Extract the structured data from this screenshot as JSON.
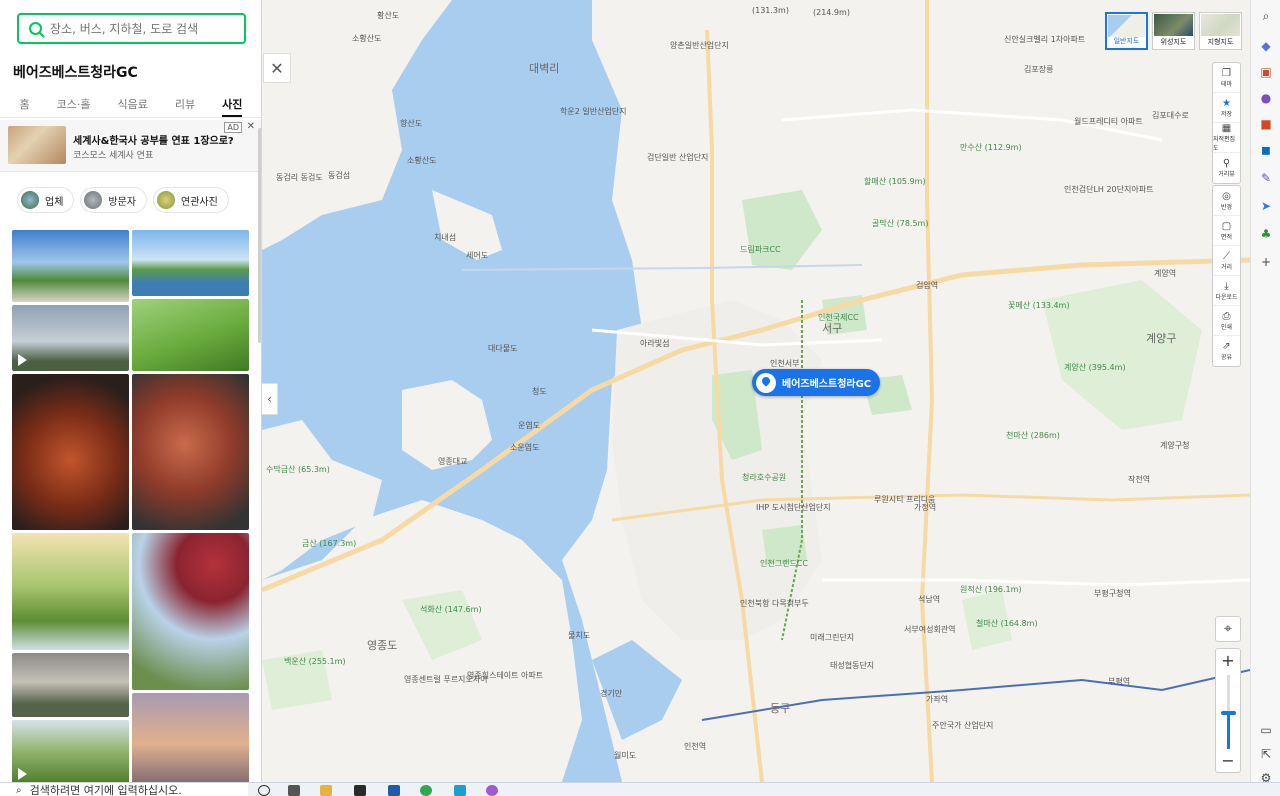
{
  "search": {
    "placeholder": "장소, 버스, 지하철, 도로 검색"
  },
  "place": {
    "title": "베어즈베스트청라GC"
  },
  "tabs": [
    {
      "label": "홈"
    },
    {
      "label": "코스·홀"
    },
    {
      "label": "식음료"
    },
    {
      "label": "리뷰"
    },
    {
      "label": "사진"
    }
  ],
  "ad": {
    "title": "세계사&한국사 공부를 연표 1장으로?",
    "subtitle": "코스모스 세계사 연표",
    "badge": "AD",
    "close": "✕"
  },
  "filters": [
    {
      "label": "업체"
    },
    {
      "label": "방문자"
    },
    {
      "label": "연관사진"
    }
  ],
  "map": {
    "marker_label": "베어즈베스트청라GC",
    "map_types": [
      {
        "label": "일반지도"
      },
      {
        "label": "위성지도"
      },
      {
        "label": "지형지도"
      }
    ],
    "toolbar": [
      {
        "label": "테마",
        "icon": "layers-icon"
      },
      {
        "label": "저장",
        "icon": "star-icon"
      },
      {
        "label": "지적편집도",
        "icon": "grid-icon"
      },
      {
        "label": "거리뷰",
        "icon": "pin-icon"
      }
    ],
    "toolbar2": [
      {
        "label": "반경",
        "icon": "radius-icon"
      },
      {
        "label": "면적",
        "icon": "area-icon"
      },
      {
        "label": "거리",
        "icon": "ruler-icon"
      },
      {
        "label": "다운로드",
        "icon": "download-icon"
      },
      {
        "label": "인쇄",
        "icon": "print-icon"
      },
      {
        "label": "공유",
        "icon": "share-icon"
      }
    ],
    "labels": {
      "l1": "황산도",
      "l2": "소황산도",
      "l3": "대벽리",
      "l4": "양촌일반산업단지",
      "l5": "학운2 일반산업단지",
      "l6": "검단일반 산업단지",
      "l7": "향산도",
      "l8": "소황산도",
      "l9": "동검리 동검도",
      "l10": "동검섬",
      "l11": "세어도",
      "l12": "치내섬",
      "l13": "드림파크CC",
      "l14": "서구",
      "l15": "인천국제CC",
      "l16": "아라빛섬",
      "l17": "대다물도",
      "l18": "청도",
      "l19": "운염도",
      "l20": "소운염도",
      "l21": "영종대교",
      "l22": "수막금산 (65.3m)",
      "l23": "금산 (167.3m)",
      "l24": "석화산 (147.6m)",
      "l25": "영종도",
      "l26": "백운산 (255.1m)",
      "l27": "영종센트럴 푸르지오자이",
      "l28": "영종힐스테이트 아파트",
      "l29": "물치도",
      "l30": "경기만",
      "l31": "월미도",
      "l32": "인천역",
      "l33": "동구",
      "l34": "청라호수공원",
      "l35": "IHP 도시첨단산업단지",
      "l36": "인천그랜드CC",
      "l37": "인천북항 다목적부두",
      "l38": "미래그린단지",
      "l39": "태성협동단지",
      "l40": "계양구",
      "l41": "계양산 (395.4m)",
      "l42": "꽃메산 (133.4m)",
      "l43": "천마산 (286m)",
      "l44": "원적산 (196.1m)",
      "l45": "철마산 (164.8m)",
      "l46": "가정역",
      "l47": "석남역",
      "l48": "인천서부",
      "l49": "할매산 (105.9m)",
      "l50": "골막산 (78.5m)",
      "l51": "만수산 (112.9m)",
      "l52": "검암역",
      "l53": "(131.3m)",
      "l54": "(214.9m)",
      "l55": "신안실크벨리 1차아파트",
      "l56": "김포장릉",
      "l57": "월드프레디티 아파트",
      "l58": "김포대수로",
      "l59": "인천검단LH 20단지아파트",
      "l60": "루원시티 프리디움",
      "l61": "서부여성회관역",
      "l62": "가좌역",
      "l63": "주안국가 산업단지",
      "l64": "부평구청역",
      "l65": "부평역",
      "l66": "계양역",
      "l67": "작전역",
      "l68": "계양구청"
    }
  },
  "browser_sidebar": [
    {
      "icon": "search-icon"
    },
    {
      "icon": "tag-icon"
    },
    {
      "icon": "briefcase-icon"
    },
    {
      "icon": "person-icon"
    },
    {
      "icon": "office-icon"
    },
    {
      "icon": "outlook-icon"
    },
    {
      "icon": "edit-icon"
    },
    {
      "icon": "send-icon"
    },
    {
      "icon": "tree-icon"
    },
    {
      "icon": "plus-icon"
    }
  ],
  "taskbar": {
    "search_text": "검색하려면 여기에 입력하십시오."
  }
}
